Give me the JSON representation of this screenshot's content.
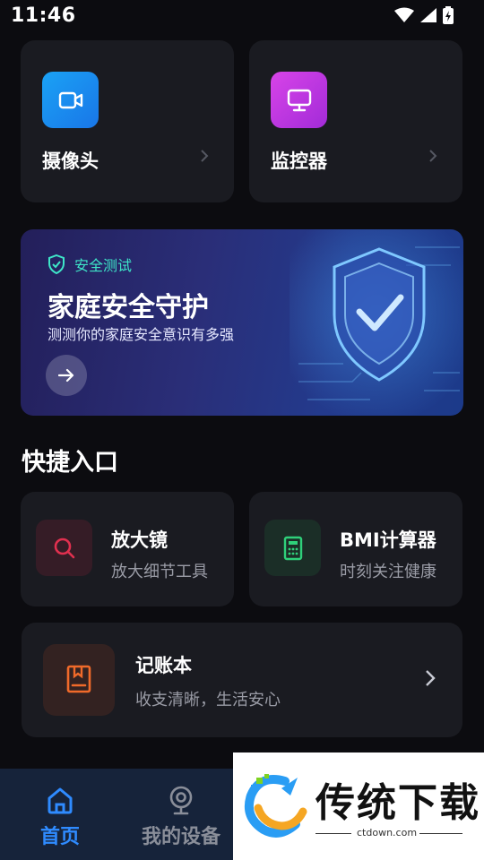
{
  "status": {
    "time": "11:46"
  },
  "devices": [
    {
      "label": "摄像头",
      "icon": "video-camera-icon",
      "color": "#1a8df0"
    },
    {
      "label": "监控器",
      "icon": "monitor-icon",
      "color": "#c23be6"
    }
  ],
  "banner": {
    "tag": "安全测试",
    "title": "家庭安全守护",
    "subtitle": "测测你的家庭安全意识有多强"
  },
  "quick": {
    "title": "快捷入口",
    "items": [
      {
        "title": "放大镜",
        "subtitle": "放大细节工具",
        "icon": "search-icon",
        "color": "#e0304f"
      },
      {
        "title": "BMI计算器",
        "subtitle": "时刻关注健康",
        "icon": "calculator-icon",
        "color": "#2fd07a"
      }
    ],
    "ledger": {
      "title": "记账本",
      "subtitle": "收支清晰，生活安心",
      "icon": "book-icon",
      "color": "#f06a2a"
    }
  },
  "tabs": [
    {
      "label": "首页",
      "icon": "home-icon",
      "active": true
    },
    {
      "label": "我的设备",
      "icon": "webcam-icon",
      "active": false
    }
  ],
  "watermark": {
    "text": "传统下载",
    "url": "ctdown.com"
  }
}
